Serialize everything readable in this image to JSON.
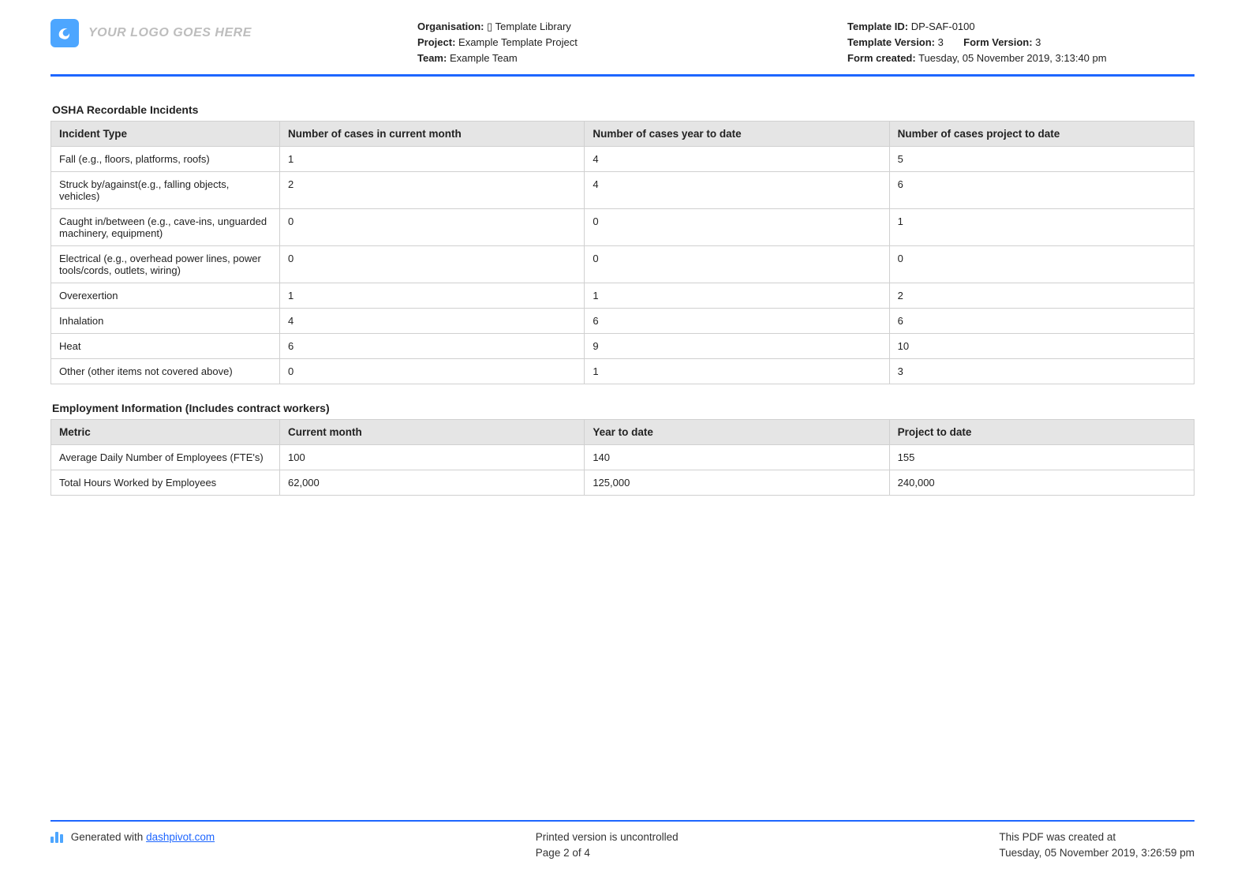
{
  "header": {
    "logo_placeholder": "YOUR LOGO GOES HERE",
    "org_label": "Organisation:",
    "org_value": "▯ Template Library",
    "project_label": "Project:",
    "project_value": "Example Template Project",
    "team_label": "Team:",
    "team_value": "Example Team",
    "template_id_label": "Template ID:",
    "template_id_value": "DP-SAF-0100",
    "template_version_label": "Template Version:",
    "template_version_value": "3",
    "form_version_label": "Form Version:",
    "form_version_value": "3",
    "form_created_label": "Form created:",
    "form_created_value": "Tuesday, 05 November 2019, 3:13:40 pm"
  },
  "section1": {
    "title": "OSHA Recordable Incidents",
    "headers": [
      "Incident Type",
      "Number of cases in current month",
      "Number of cases year to date",
      "Number of cases project to date"
    ],
    "rows": [
      {
        "type": "Fall (e.g., floors, platforms, roofs)",
        "current": "1",
        "ytd": "4",
        "ptd": "5"
      },
      {
        "type": "Struck by/against(e.g., falling objects, vehicles)",
        "current": "2",
        "ytd": "4",
        "ptd": "6"
      },
      {
        "type": "Caught in/between (e.g., cave-ins, unguarded machinery, equipment)",
        "current": "0",
        "ytd": "0",
        "ptd": "1"
      },
      {
        "type": "Electrical (e.g., overhead power lines, power tools/cords, outlets, wiring)",
        "current": "0",
        "ytd": "0",
        "ptd": "0"
      },
      {
        "type": "Overexertion",
        "current": "1",
        "ytd": "1",
        "ptd": "2"
      },
      {
        "type": "Inhalation",
        "current": "4",
        "ytd": "6",
        "ptd": "6"
      },
      {
        "type": "Heat",
        "current": "6",
        "ytd": "9",
        "ptd": "10"
      },
      {
        "type": "Other (other items not covered above)",
        "current": "0",
        "ytd": "1",
        "ptd": "3"
      }
    ]
  },
  "section2": {
    "title": "Employment Information (Includes contract workers)",
    "headers": [
      "Metric",
      "Current month",
      "Year to date",
      "Project to date"
    ],
    "rows": [
      {
        "metric": "Average Daily Number of Employees (FTE's)",
        "current": "100",
        "ytd": "140",
        "ptd": "155"
      },
      {
        "metric": "Total Hours Worked by Employees",
        "current": "62,000",
        "ytd": "125,000",
        "ptd": "240,000"
      }
    ]
  },
  "footer": {
    "generated_prefix": "Generated with ",
    "generated_link_text": "dashpivot.com",
    "printed_note": "Printed version is uncontrolled",
    "page_label": "Page 2 of 4",
    "created_label": "This PDF was created at",
    "created_value": "Tuesday, 05 November 2019, 3:26:59 pm"
  }
}
